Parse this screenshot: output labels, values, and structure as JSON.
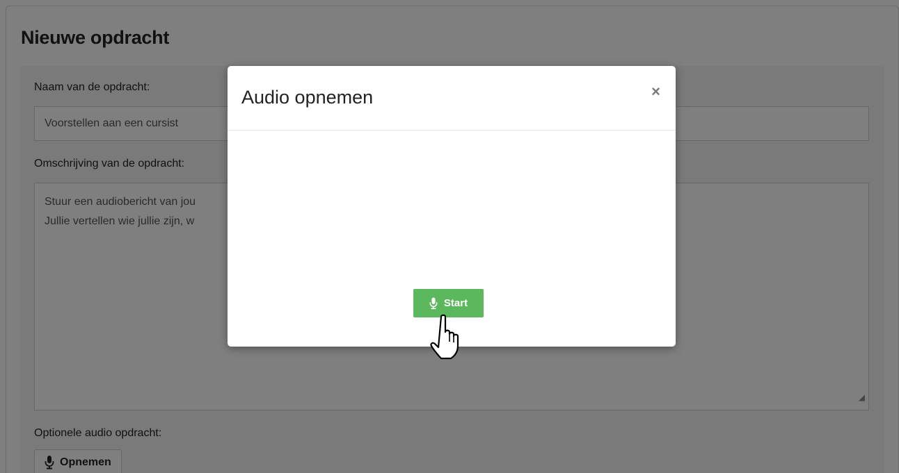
{
  "page": {
    "title": "Nieuwe opdracht"
  },
  "form": {
    "name_label": "Naam van de opdracht:",
    "name_value": "Voorstellen aan een cursist",
    "description_label": "Omschrijving van de opdracht:",
    "description_lines": [
      "Stuur een audiobericht van jou",
      "Jullie vertellen wie jullie zijn, w"
    ],
    "audio_label": "Optionele audio opdracht:",
    "record_button_label": "Opnemen",
    "record_button_icon": "microphone-icon"
  },
  "modal": {
    "title": "Audio opnemen",
    "close_symbol": "×",
    "start_button_label": "Start",
    "start_button_icon": "microphone-icon",
    "start_button_color": "#5cb85c"
  },
  "colors": {
    "overlay": "rgba(0,0,0,0.5)",
    "accent_green": "#5cb85c"
  }
}
